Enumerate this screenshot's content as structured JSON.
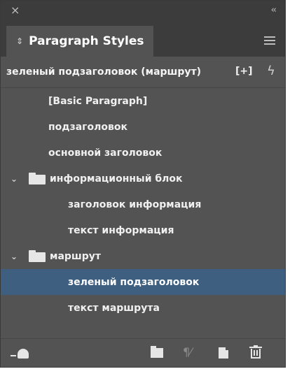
{
  "window": {
    "close_glyph": "×",
    "collapse_glyph": "‹‹"
  },
  "panel": {
    "tab_title": "Paragraph Styles",
    "tab_arrows_glyph": "⇕",
    "menu_icon": "hamburger-menu-icon"
  },
  "current_style": {
    "label": "зеленый подзаголовок (маршрут)",
    "plus_glyph": "[+]",
    "bolt_glyph": "ϟ"
  },
  "styles": [
    {
      "label": "[Basic Paragraph]",
      "type": "style",
      "selected": false
    },
    {
      "label": "подзаголовок",
      "type": "style",
      "selected": false
    },
    {
      "label": "основной заголовок",
      "type": "style",
      "selected": false
    },
    {
      "label": "информационный блок",
      "type": "group",
      "expanded": true,
      "selected": false
    },
    {
      "label": "заголовок информация",
      "type": "style",
      "selected": false
    },
    {
      "label": "текст информация",
      "type": "style",
      "selected": false
    },
    {
      "label": "маршрут",
      "type": "group",
      "expanded": true,
      "selected": false
    },
    {
      "label": "зеленый подзаголовок",
      "type": "style",
      "selected": true
    },
    {
      "label": "текст маршрута",
      "type": "style",
      "selected": false
    }
  ],
  "chevron_glyph": "⌄",
  "footer": {
    "pilcrow_glyph": "¶⁄",
    "icons": [
      "cloud-library-icon",
      "new-group-icon",
      "clear-overrides-icon",
      "new-style-icon",
      "delete-icon"
    ]
  },
  "colors": {
    "panel_bg": "#535353",
    "header_bg": "#3c3c3c",
    "selection_bg": "#3f5f80",
    "text": "#f0f0f0"
  }
}
